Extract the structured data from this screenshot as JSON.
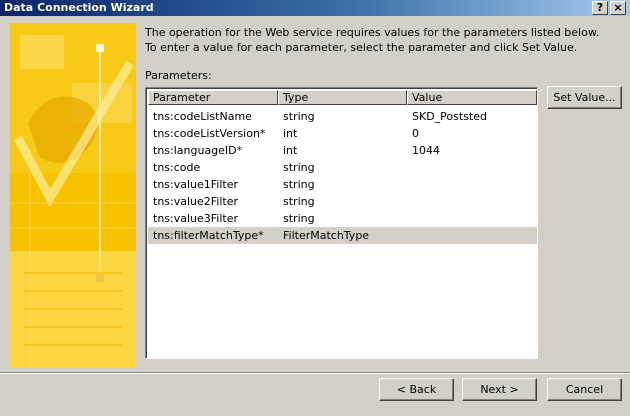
{
  "window": {
    "title": "Data Connection Wizard",
    "help_glyph": "?",
    "close_glyph": "×"
  },
  "intro": {
    "line1": "The operation for the Web service requires values for the parameters listed below.",
    "line2": "To enter a value for each parameter, select the parameter and click Set Value."
  },
  "parameters_label": "Parameters:",
  "columns": [
    "Parameter",
    "Type",
    "Value"
  ],
  "rows": [
    {
      "parameter": "tns:codeListName",
      "type": "string",
      "value": "SKD_Poststed"
    },
    {
      "parameter": "tns:codeListVersion*",
      "type": "int",
      "value": "0"
    },
    {
      "parameter": "tns:languageID*",
      "type": "int",
      "value": "1044"
    },
    {
      "parameter": "tns:code",
      "type": "string",
      "value": ""
    },
    {
      "parameter": "tns:value1Filter",
      "type": "string",
      "value": ""
    },
    {
      "parameter": "tns:value2Filter",
      "type": "string",
      "value": ""
    },
    {
      "parameter": "tns:value3Filter",
      "type": "string",
      "value": ""
    },
    {
      "parameter": "tns:filterMatchType*",
      "type": "FilterMatchType",
      "value": ""
    }
  ],
  "selected_row": 7,
  "buttons": {
    "set_value": "Set Value...",
    "back": "< Back",
    "next": "Next >",
    "cancel": "Cancel"
  },
  "colors": {
    "dialog_bg": "#d4d0c8",
    "title_gradient_start": "#0a246a",
    "side_panel": "#f5c000"
  }
}
